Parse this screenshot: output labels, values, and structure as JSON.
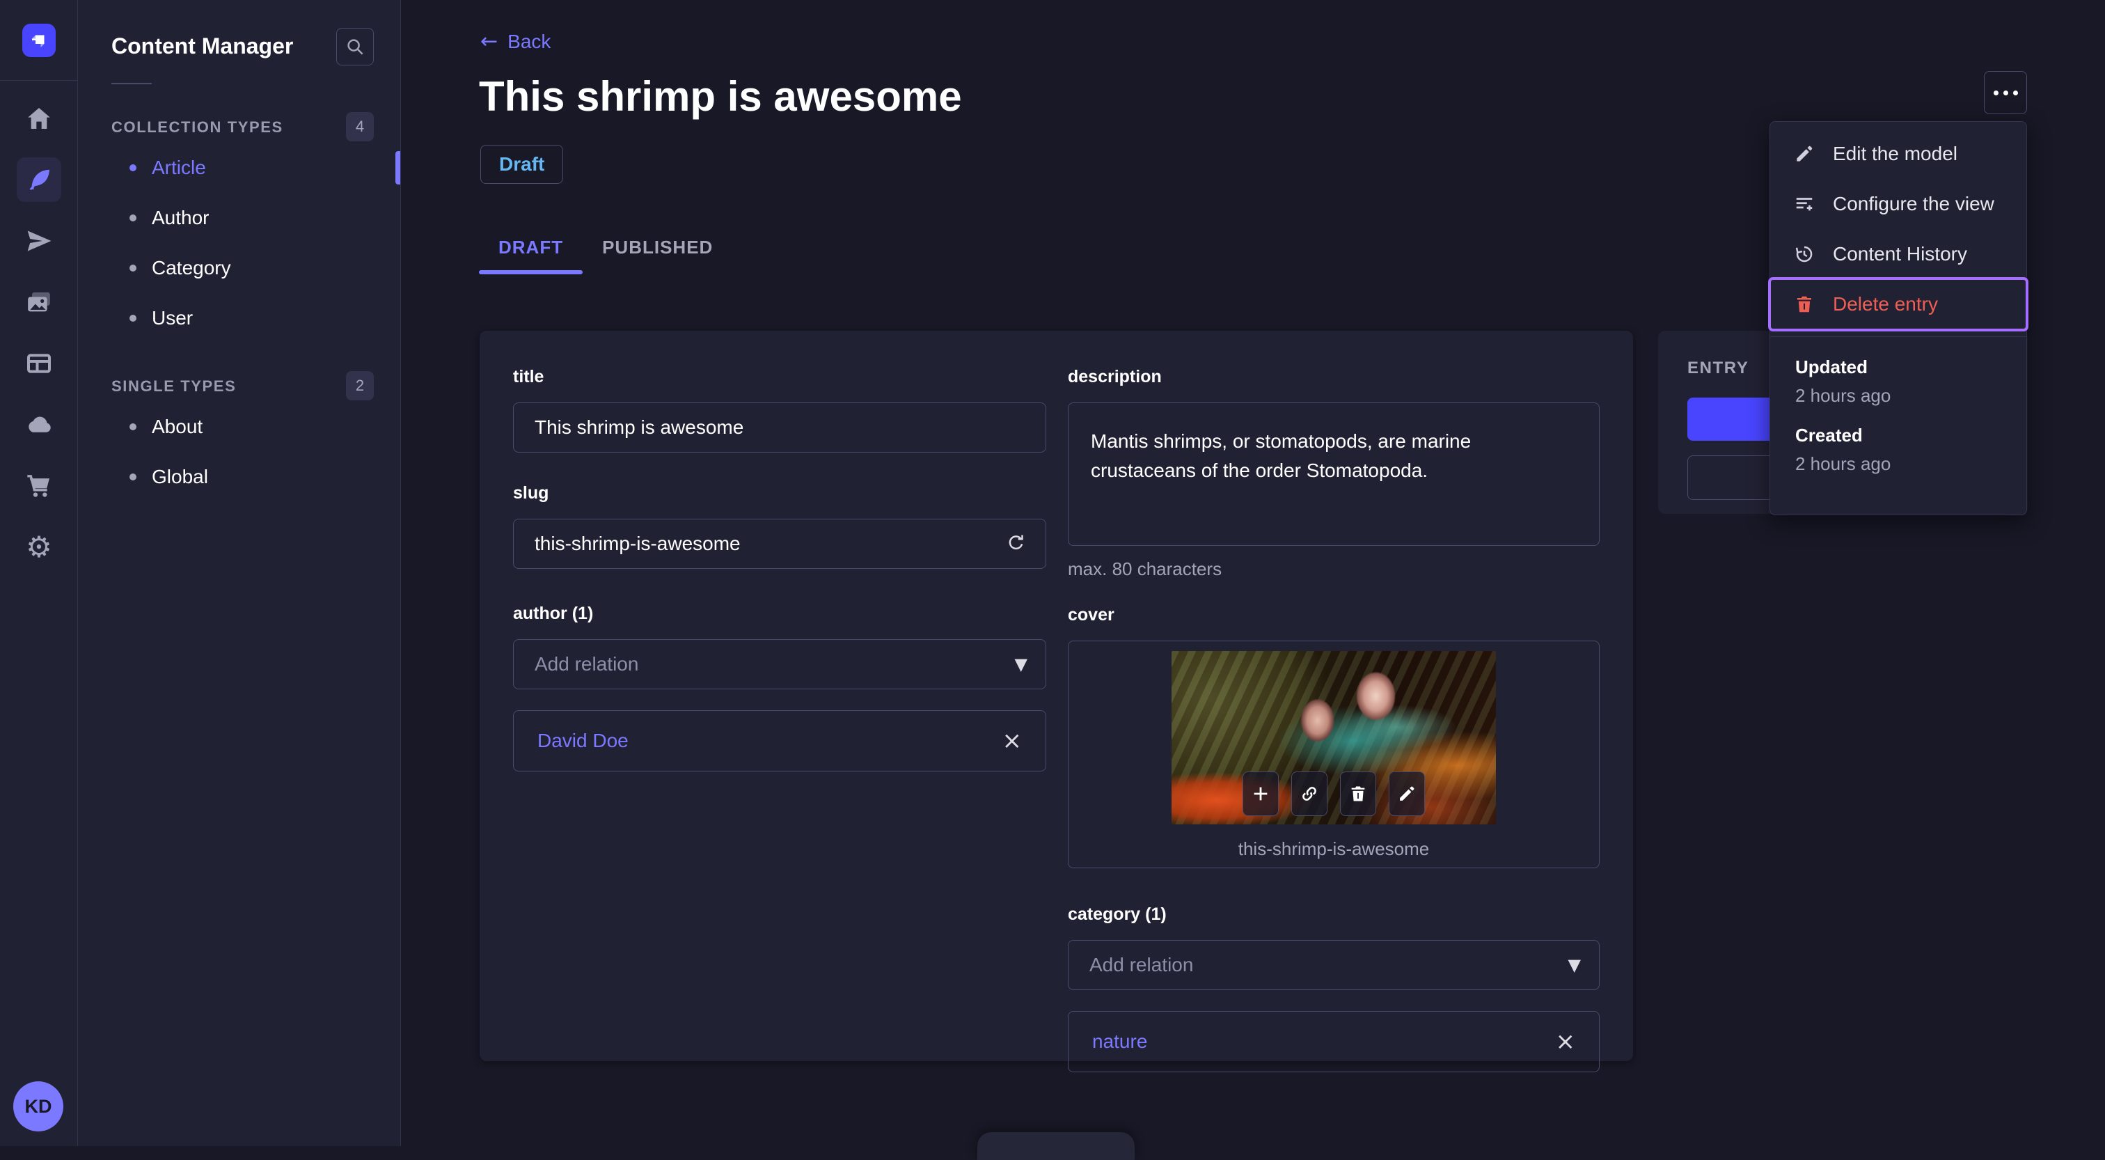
{
  "colors": {
    "page_bg": "#181826",
    "panel_bg": "#212134",
    "accent": "#7b79ff",
    "primary_button": "#4945ff",
    "danger": "#ee5e52",
    "draft_badge": "#66b7f1",
    "annotation_highlight": "#a56eff",
    "border": "#4a4a6a",
    "text_muted": "#a5a5ba"
  },
  "nav_rail": {
    "icons": [
      "strapi-logo",
      "home",
      "feather",
      "paper-plane",
      "media-library",
      "layout-builder",
      "cloud",
      "cart",
      "gear"
    ],
    "avatar_initials": "KD"
  },
  "sidebar": {
    "title": "Content Manager",
    "sections": [
      {
        "label": "COLLECTION TYPES",
        "count": "4",
        "items": [
          {
            "label": "Article",
            "active": true
          },
          {
            "label": "Author",
            "active": false
          },
          {
            "label": "Category",
            "active": false
          },
          {
            "label": "User",
            "active": false
          }
        ]
      },
      {
        "label": "SINGLE TYPES",
        "count": "2",
        "items": [
          {
            "label": "About",
            "active": false
          },
          {
            "label": "Global",
            "active": false
          }
        ]
      }
    ]
  },
  "header": {
    "back": "Back",
    "title": "This shrimp is awesome",
    "status": "Draft",
    "tabs": [
      "DRAFT",
      "PUBLISHED"
    ]
  },
  "menu": {
    "items": [
      "Edit the model",
      "Configure the view",
      "Content History",
      "Delete entry"
    ],
    "meta": [
      {
        "label": "Updated",
        "value": "2 hours ago"
      },
      {
        "label": "Created",
        "value": "2 hours ago"
      }
    ]
  },
  "entry_panel": {
    "title": "ENTRY"
  },
  "form": {
    "title": {
      "label": "title",
      "value": "This shrimp is awesome"
    },
    "description": {
      "label": "description",
      "value": "Mantis shrimps, or stomatopods, are marine crustaceans of the order Stomatopoda.",
      "helper": "max. 80 characters"
    },
    "slug": {
      "label": "slug",
      "value": "this-shrimp-is-awesome"
    },
    "cover": {
      "label": "cover",
      "caption": "this-shrimp-is-awesome"
    },
    "author": {
      "label": "author (1)",
      "placeholder": "Add relation",
      "relations": [
        "David Doe"
      ]
    },
    "category": {
      "label": "category (1)",
      "placeholder": "Add relation",
      "relations": [
        "nature"
      ]
    }
  }
}
